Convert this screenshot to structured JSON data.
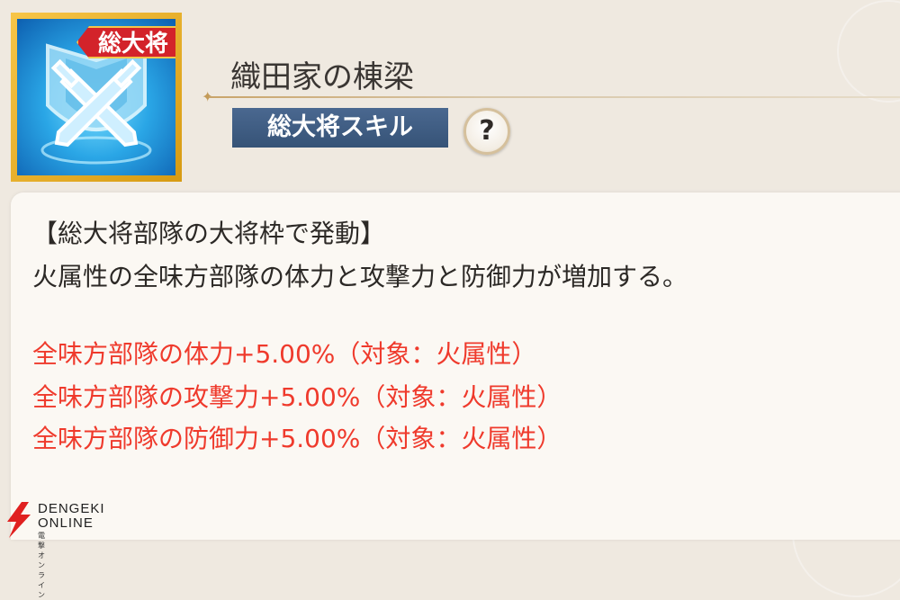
{
  "skill": {
    "badge": "総大将",
    "title": "織田家の棟梁",
    "type_label": "総大将スキル",
    "help": "?"
  },
  "description": {
    "condition": "【総大将部隊の大将枠で発動】",
    "summary": "火属性の全味方部隊の体力と攻撃力と防御力が増加する。"
  },
  "effects": [
    "全味方部隊の体力+5.00%（対象：火属性）",
    "全味方部隊の攻撃力+5.00%（対象：火属性）",
    "全味方部隊の防御力+5.00%（対象：火属性）"
  ],
  "watermark": {
    "line1": "DENGEKI",
    "line2": "ONLINE",
    "line3": "電撃オンライン"
  },
  "colors": {
    "effect_text": "#ef3a2c",
    "type_label_bg": "#3f5c84",
    "badge_bg": "#d3232a",
    "icon_frame": "#e5aa1d"
  }
}
